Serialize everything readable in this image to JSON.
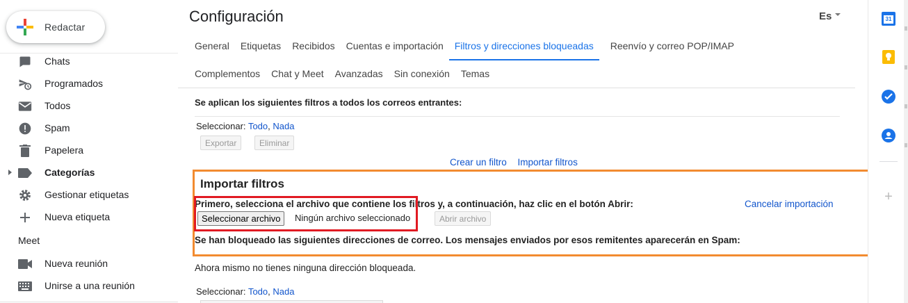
{
  "compose": {
    "label": "Redactar"
  },
  "nav": [
    {
      "label": "Chats",
      "icon": "chat-icon",
      "bold": false,
      "caret": false
    },
    {
      "label": "Programados",
      "icon": "scheduled-icon",
      "bold": false,
      "caret": false
    },
    {
      "label": "Todos",
      "icon": "all-mail-icon",
      "bold": false,
      "caret": false
    },
    {
      "label": "Spam",
      "icon": "spam-icon",
      "bold": false,
      "caret": false
    },
    {
      "label": "Papelera",
      "icon": "trash-icon",
      "bold": false,
      "caret": false
    },
    {
      "label": "Categorías",
      "icon": "label-icon",
      "bold": true,
      "caret": true
    },
    {
      "label": "Gestionar etiquetas",
      "icon": "gear-icon",
      "bold": false,
      "caret": false
    },
    {
      "label": "Nueva etiqueta",
      "icon": "plus-icon",
      "bold": false,
      "caret": false
    }
  ],
  "meet": {
    "heading": "Meet",
    "items": [
      {
        "label": "Nueva reunión",
        "icon": "video-icon"
      },
      {
        "label": "Unirse a una reunión",
        "icon": "keyboard-icon"
      }
    ]
  },
  "header": {
    "title": "Configuración",
    "language": "Es"
  },
  "tabs_row1": [
    "General",
    "Etiquetas",
    "Recibidos",
    "Cuentas e importación",
    "Filtros y direcciones bloqueadas",
    "Reenvío y correo POP/IMAP"
  ],
  "tabs_row2": [
    "Complementos",
    "Chat y Meet",
    "Avanzadas",
    "Sin conexión",
    "Temas"
  ],
  "active_tab": "Filtros y direcciones bloqueadas",
  "filters": {
    "heading": "Se aplican los siguientes filtros a todos los correos entrantes:",
    "select_label": "Seleccionar:",
    "select_all": "Todo",
    "select_comma": ",",
    "select_none": "Nada",
    "export_label": "Exportar",
    "delete_label": "Eliminar",
    "create_link": "Crear un filtro",
    "import_link": "Importar filtros"
  },
  "import": {
    "title": "Importar filtros",
    "instruction": "Primero, selecciona el archivo que contiene los filtros y, a continuación, haz clic en el botón Abrir:",
    "cancel_link": "Cancelar importación",
    "choose_file": "Seleccionar archivo",
    "no_file": "Ningún archivo seleccionado",
    "open_file": "Abrir archivo"
  },
  "blocked": {
    "heading": "Se han bloqueado las siguientes direcciones de correo. Los mensajes enviados por esos remitentes aparecerán en Spam:",
    "empty_text": "Ahora mismo no tienes ninguna dirección bloqueada.",
    "select_label": "Seleccionar:",
    "select_all": "Todo",
    "select_comma": ",",
    "select_none": "Nada"
  },
  "right_panel": [
    {
      "icon": "calendar-icon",
      "badge": "31"
    },
    {
      "icon": "keep-icon"
    },
    {
      "icon": "tasks-icon"
    },
    {
      "icon": "contacts-icon"
    }
  ],
  "colors": {
    "accent": "#1a73e8",
    "link": "#1155cc",
    "highlight_orange": "#f28b30",
    "highlight_red": "#e11a22"
  }
}
